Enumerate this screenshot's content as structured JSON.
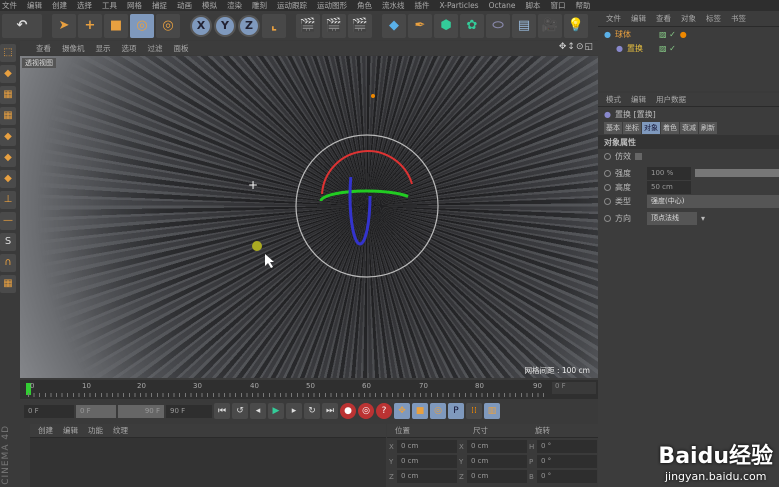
{
  "menubar": [
    "文件",
    "编辑",
    "创建",
    "选择",
    "工具",
    "网格",
    "捕捉",
    "动画",
    "模拟",
    "渲染",
    "雕刻",
    "运动跟踪",
    "运动图形",
    "角色",
    "流水线",
    "插件",
    "X-Particles",
    "Octane",
    "脚本",
    "窗口",
    "帮助"
  ],
  "toolbar": {
    "x": "X",
    "y": "Y",
    "z": "Z"
  },
  "viewport": {
    "menu": [
      "查看",
      "摄像机",
      "显示",
      "选项",
      "过滤",
      "面板"
    ],
    "label": "透视视图",
    "grid": "网格间距 : 100 cm"
  },
  "timeline": {
    "ticks": [
      "0",
      "10",
      "20",
      "30",
      "40",
      "50",
      "60",
      "70",
      "80",
      "90"
    ],
    "current": "0 F"
  },
  "playback": {
    "start": "0 F",
    "range_start": "0 F",
    "range_end": "90 F",
    "end": "90 F"
  },
  "material": {
    "menu": [
      "创建",
      "编辑",
      "功能",
      "纹理"
    ]
  },
  "coords": {
    "headers": [
      "位置",
      "尺寸",
      "旋转"
    ],
    "rows": [
      [
        "X",
        "0 cm",
        "X",
        "0 cm",
        "H",
        "0 °"
      ],
      [
        "Y",
        "0 cm",
        "Y",
        "0 cm",
        "P",
        "0 °"
      ],
      [
        "Z",
        "0 cm",
        "Z",
        "0 cm",
        "B",
        "0 °"
      ]
    ]
  },
  "objmgr": {
    "menu": [
      "文件",
      "编辑",
      "查看",
      "对象",
      "标签",
      "书签"
    ],
    "objects": [
      "球体",
      "置换"
    ]
  },
  "attr": {
    "menu": [
      "模式",
      "编辑",
      "用户数据"
    ],
    "title": "置换 [置换]",
    "tabs": [
      "基本",
      "坐标",
      "对象",
      "着色",
      "衰减",
      "刷新"
    ],
    "section": "对象属性",
    "emulate": "仿效",
    "strength_label": "强度",
    "strength": "100 %",
    "height_label": "高度",
    "height": "50 cm",
    "type_label": "类型",
    "type": "强度(中心)",
    "dir_label": "方向",
    "dir": "顶点法线"
  },
  "brand": "CINEMA 4D",
  "watermark": {
    "logo": "Baidu经验",
    "url": "jingyan.baidu.com"
  }
}
